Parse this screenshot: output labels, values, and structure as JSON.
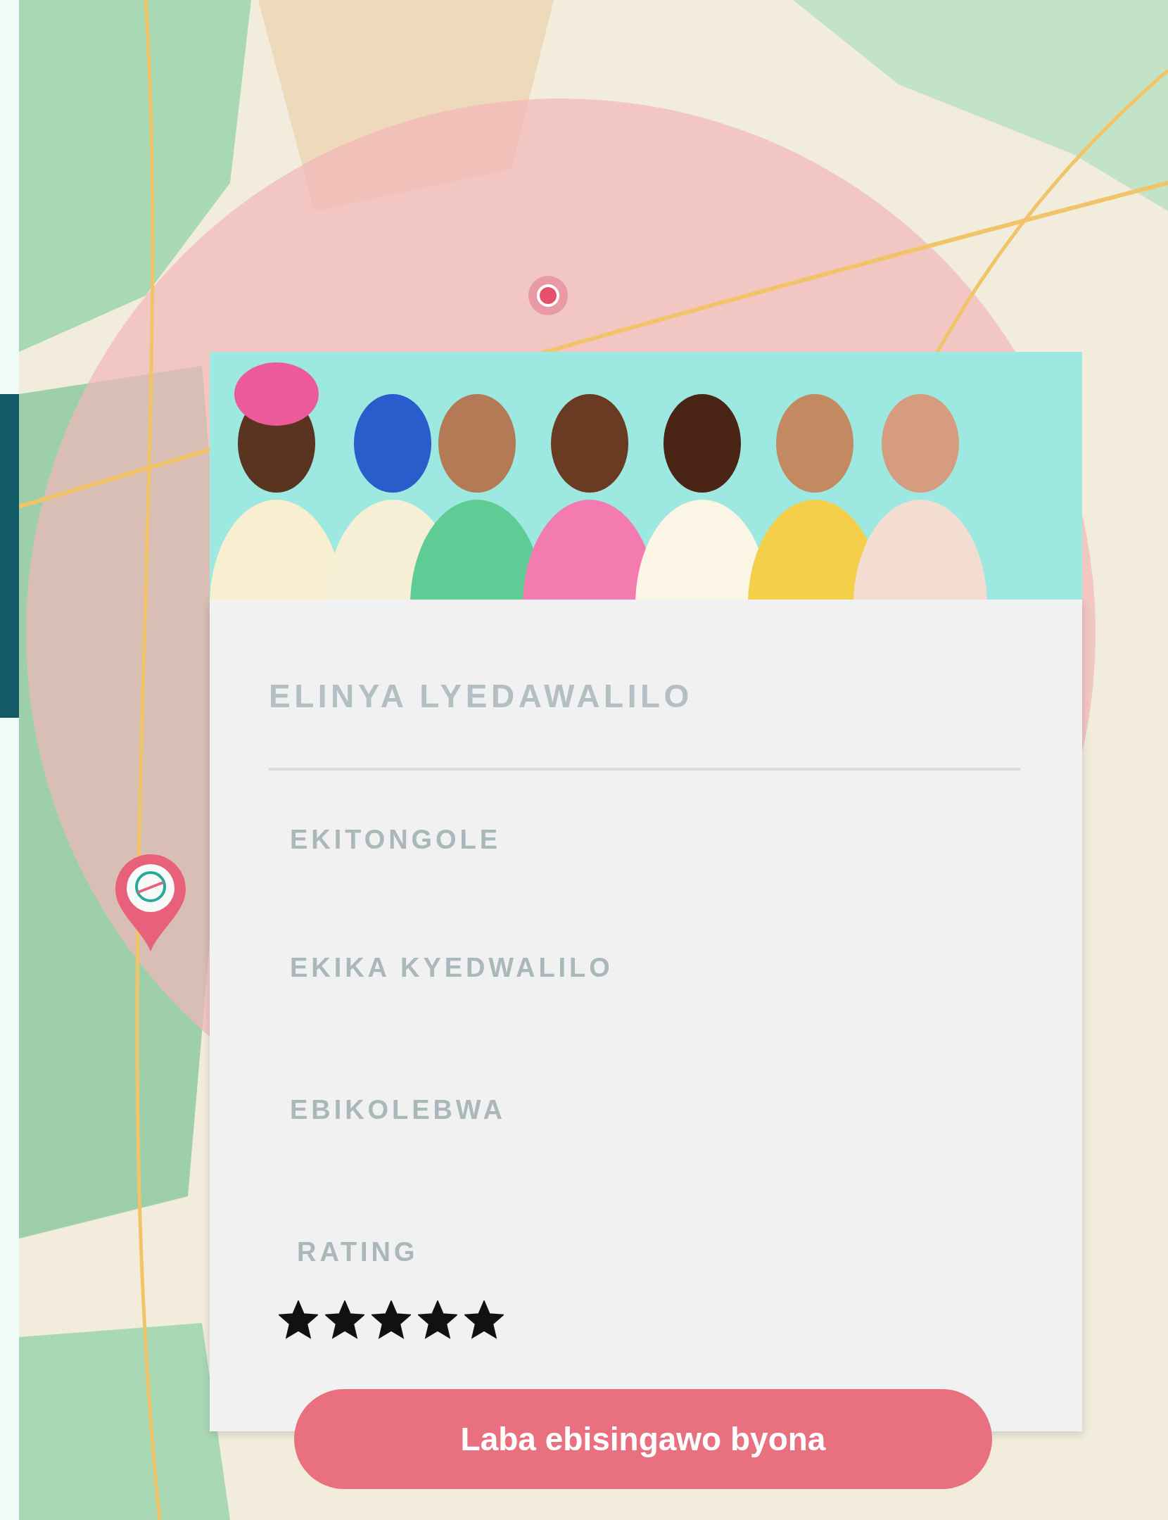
{
  "card": {
    "title": "ELINYA LYEDAWALILO",
    "fields": [
      {
        "label": "EKITONGOLE"
      },
      {
        "label": "EKIKA KYEDWALILO"
      },
      {
        "label": "EBIKOLEBWA"
      }
    ],
    "rating": {
      "label": "RATING",
      "stars": 5
    },
    "button": "Laba ebisingawo byona"
  }
}
